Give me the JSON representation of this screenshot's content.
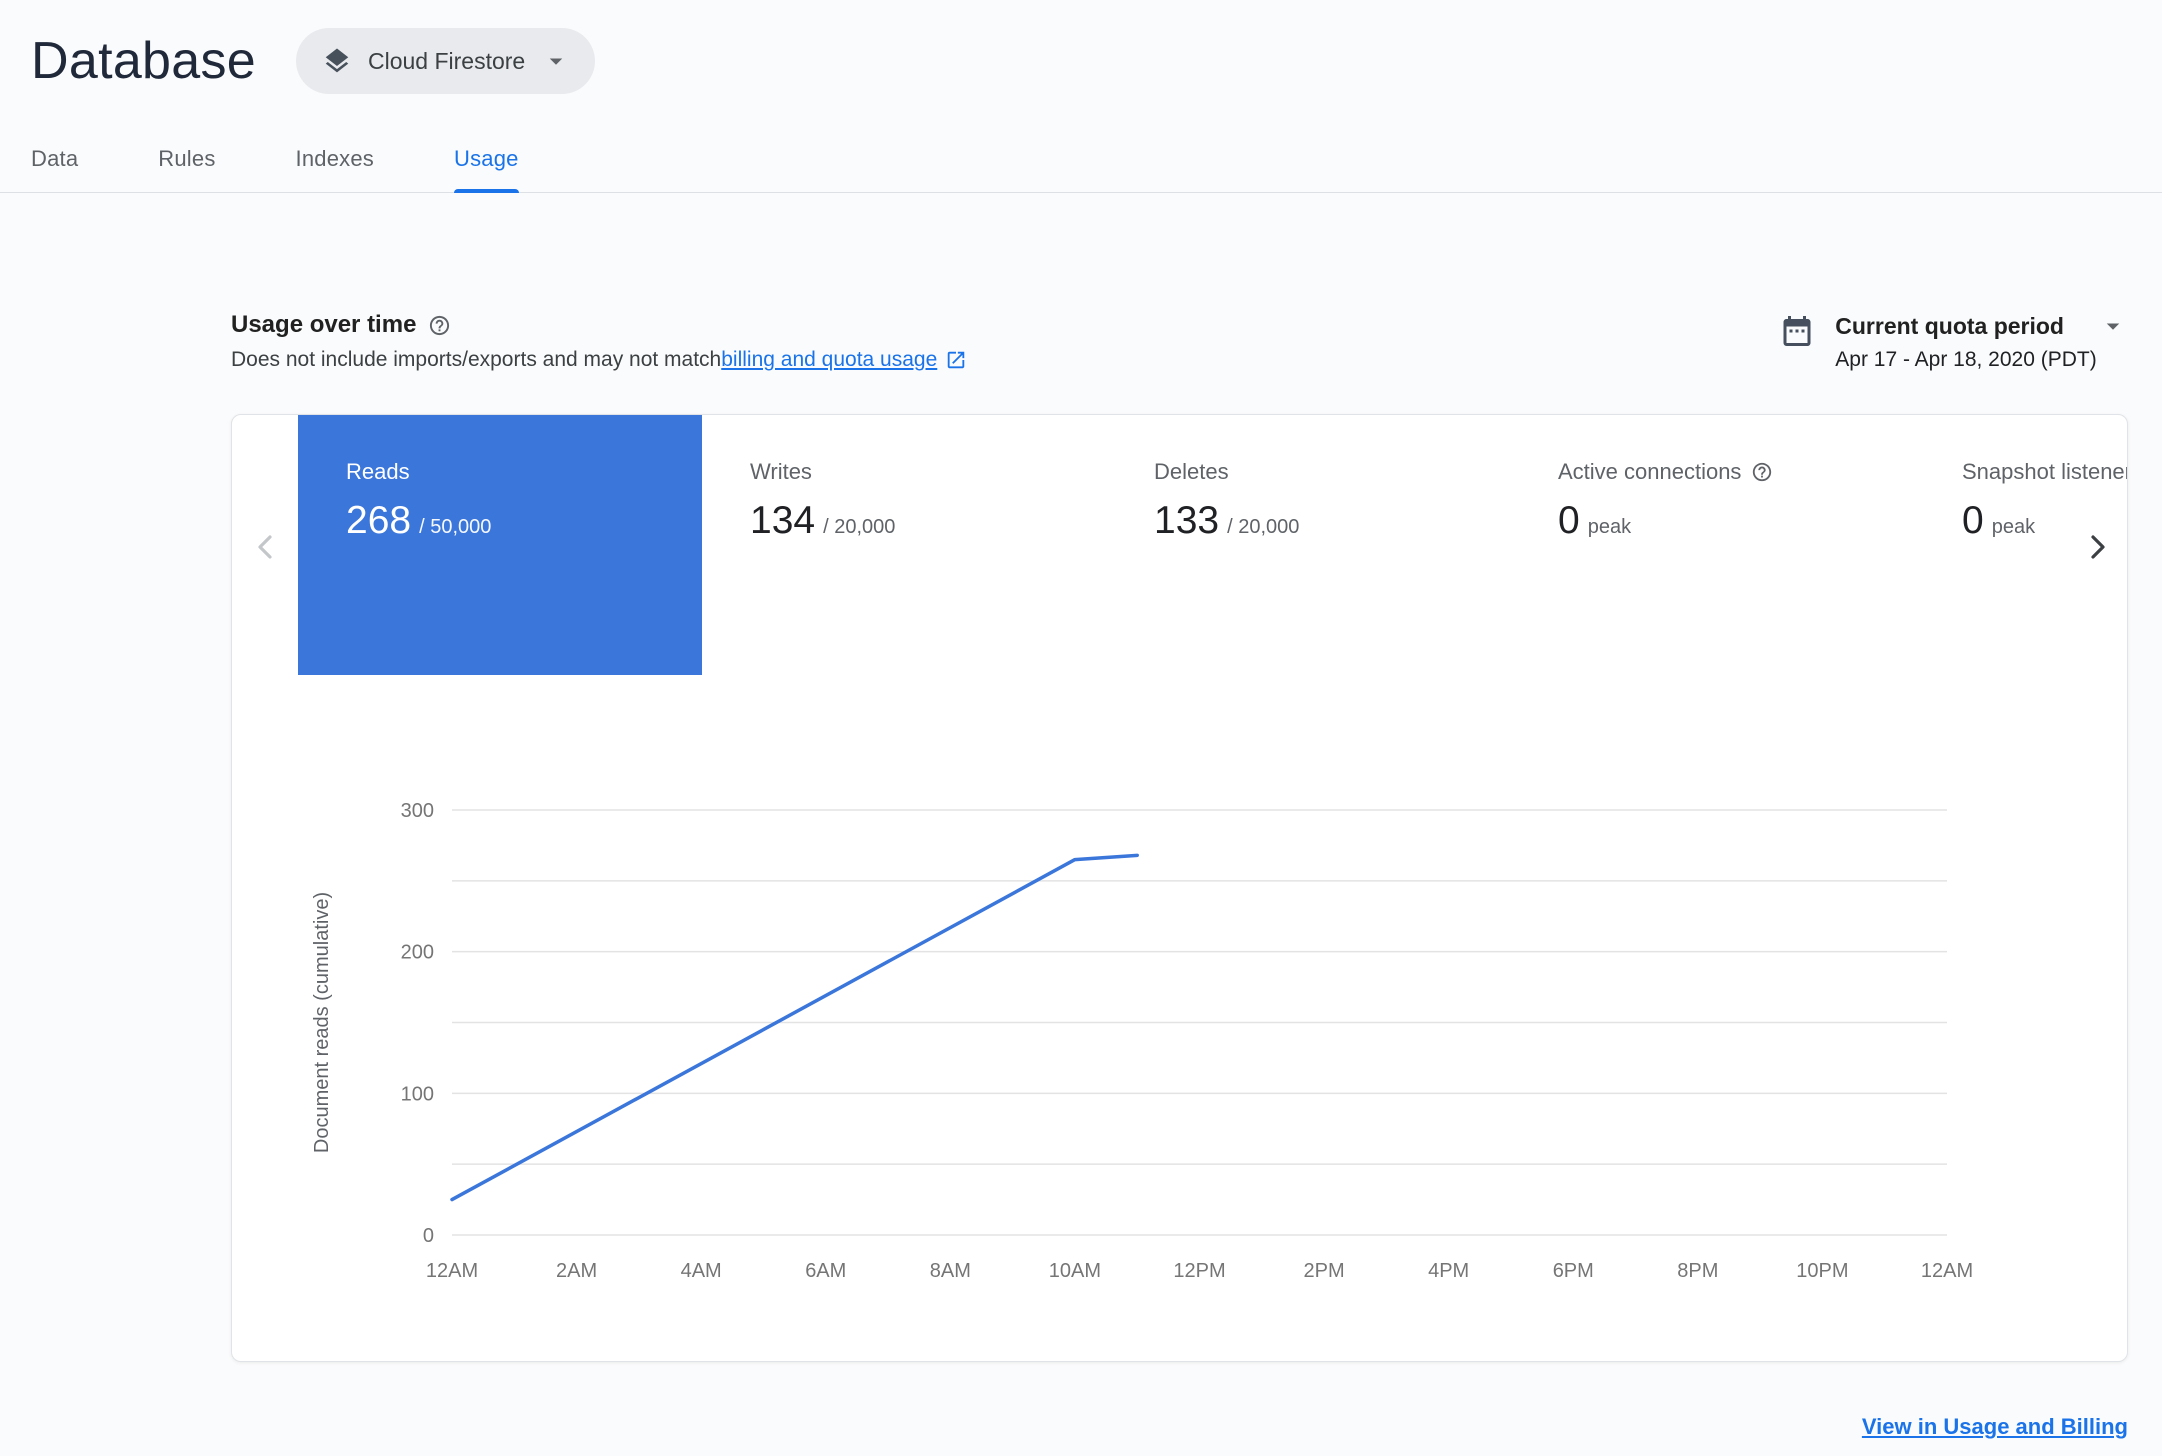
{
  "colors": {
    "accent": "#1a73e8",
    "selected_tile": "#3b76db"
  },
  "header": {
    "title": "Database",
    "database_selector": {
      "label": "Cloud Firestore"
    }
  },
  "tabs": [
    {
      "label": "Data",
      "active": false
    },
    {
      "label": "Rules",
      "active": false
    },
    {
      "label": "Indexes",
      "active": false
    },
    {
      "label": "Usage",
      "active": true
    }
  ],
  "usage_section": {
    "title": "Usage over time",
    "description_prefix": "Does not include imports/exports and may not match ",
    "description_link": "billing and quota usage",
    "quota_period": {
      "label": "Current quota period",
      "range": "Apr 17 - Apr 18, 2020 (PDT)"
    }
  },
  "metric_tiles": [
    {
      "label": "Reads",
      "value": "268",
      "quota": "/ 50,000",
      "selected": true
    },
    {
      "label": "Writes",
      "value": "134",
      "quota": "/ 20,000",
      "selected": false
    },
    {
      "label": "Deletes",
      "value": "133",
      "quota": "/ 20,000",
      "selected": false
    },
    {
      "label": "Active connections",
      "value": "0",
      "quota": "peak",
      "selected": false,
      "has_help_icon": true
    },
    {
      "label": "Snapshot listeners",
      "value": "0",
      "quota": "peak",
      "selected": false
    }
  ],
  "chart_data": {
    "type": "line",
    "title": "",
    "xlabel": "",
    "ylabel": "Document reads (cumulative)",
    "ylim": [
      0,
      300
    ],
    "y_grid_step": 50,
    "y_tick_labels": [
      0,
      100,
      200,
      300
    ],
    "x_range_hours": [
      0,
      24
    ],
    "x_ticks": [
      {
        "hour": 0,
        "label": "12AM"
      },
      {
        "hour": 2,
        "label": "2AM"
      },
      {
        "hour": 4,
        "label": "4AM"
      },
      {
        "hour": 6,
        "label": "6AM"
      },
      {
        "hour": 8,
        "label": "8AM"
      },
      {
        "hour": 10,
        "label": "10AM"
      },
      {
        "hour": 12,
        "label": "12PM"
      },
      {
        "hour": 14,
        "label": "2PM"
      },
      {
        "hour": 16,
        "label": "4PM"
      },
      {
        "hour": 18,
        "label": "6PM"
      },
      {
        "hour": 20,
        "label": "8PM"
      },
      {
        "hour": 22,
        "label": "10PM"
      },
      {
        "hour": 24,
        "label": "12AM"
      }
    ],
    "grid": true,
    "legend_position": "none",
    "series": [
      {
        "name": "Document reads (cumulative)",
        "color": "#3b76db",
        "points": [
          [
            0,
            25
          ],
          [
            10,
            265
          ],
          [
            11,
            268
          ]
        ]
      }
    ]
  },
  "footer": {
    "link_label": "View in Usage and Billing"
  }
}
